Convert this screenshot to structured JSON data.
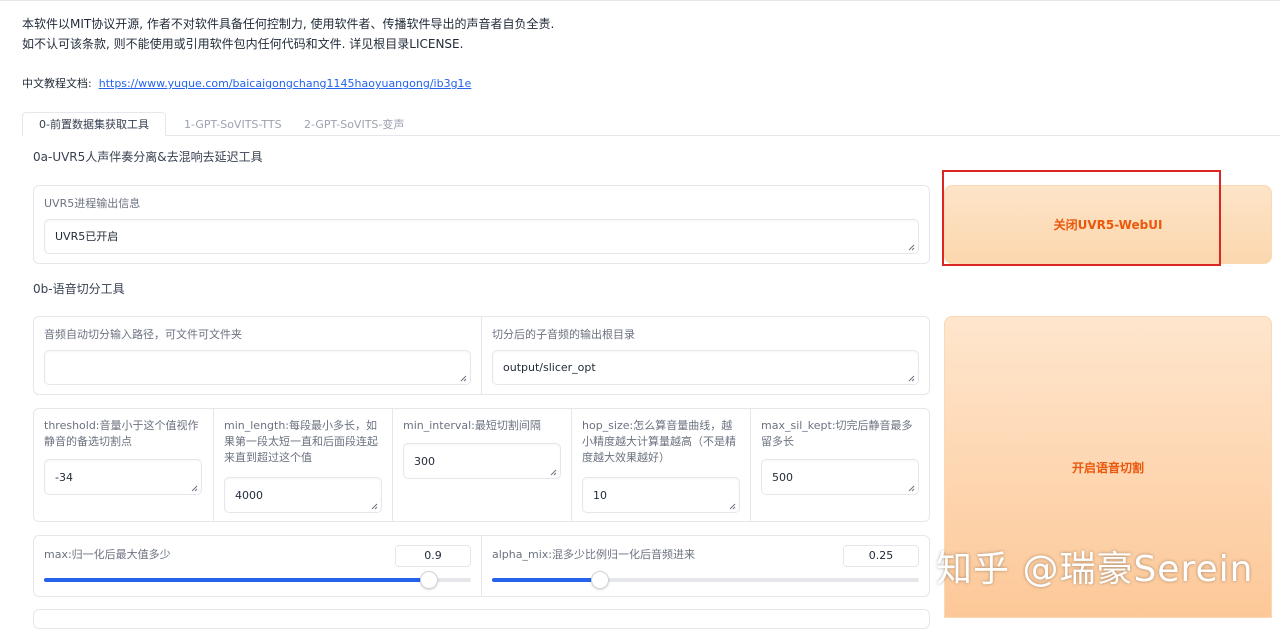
{
  "notice": {
    "line1": "本软件以MIT协议开源, 作者不对软件具备任何控制力, 使用软件者、传播软件导出的声音者自负全责.",
    "line2": "如不认可该条款, 则不能使用或引用软件包内任何代码和文件. 详见根目录LICENSE."
  },
  "doc": {
    "label": "中文教程文档:",
    "link": "https://www.yuque.com/baicaigongchang1145haoyuangong/ib3g1e"
  },
  "tabs": [
    "0-前置数据集获取工具",
    "1-GPT-SoVITS-TTS",
    "2-GPT-SoVITS-变声"
  ],
  "uvr5": {
    "title": "0a-UVR5人声伴奏分离&去混响去延迟工具",
    "output_label": "UVR5进程输出信息",
    "output_value": "UVR5已开启",
    "button": "关闭UVR5-WebUI"
  },
  "slicer": {
    "title": "0b-语音切分工具",
    "input_label": "音频自动切分输入路径，可文件可文件夹",
    "input_value": "",
    "output_label": "切分后的子音频的输出根目录",
    "output_value": "output/slicer_opt",
    "params": [
      {
        "label": "threshold:音量小于这个值视作静音的备选切割点",
        "value": "-34"
      },
      {
        "label": "min_length:每段最小多长，如果第一段太短一直和后面段连起来直到超过这个值",
        "value": "4000"
      },
      {
        "label": "min_interval:最短切割间隔",
        "value": "300"
      },
      {
        "label": "hop_size:怎么算音量曲线，越小精度越大计算量越高（不是精度越大效果越好）",
        "value": "10"
      },
      {
        "label": "max_sil_kept:切完后静音最多留多长",
        "value": "500"
      }
    ],
    "max_label": "max:归一化后最大值多少",
    "max_value": "0.9",
    "max_fraction": 0.9,
    "alpha_label": "alpha_mix:混多少比例归一化后音频进来",
    "alpha_value": "0.25",
    "alpha_fraction": 0.25,
    "button": "开启语音切割"
  },
  "watermark": "知乎 @瑞豪Serein",
  "colors": {
    "accent": "#2563eb",
    "button_text": "#ea580c",
    "highlight": "#dc2626"
  }
}
